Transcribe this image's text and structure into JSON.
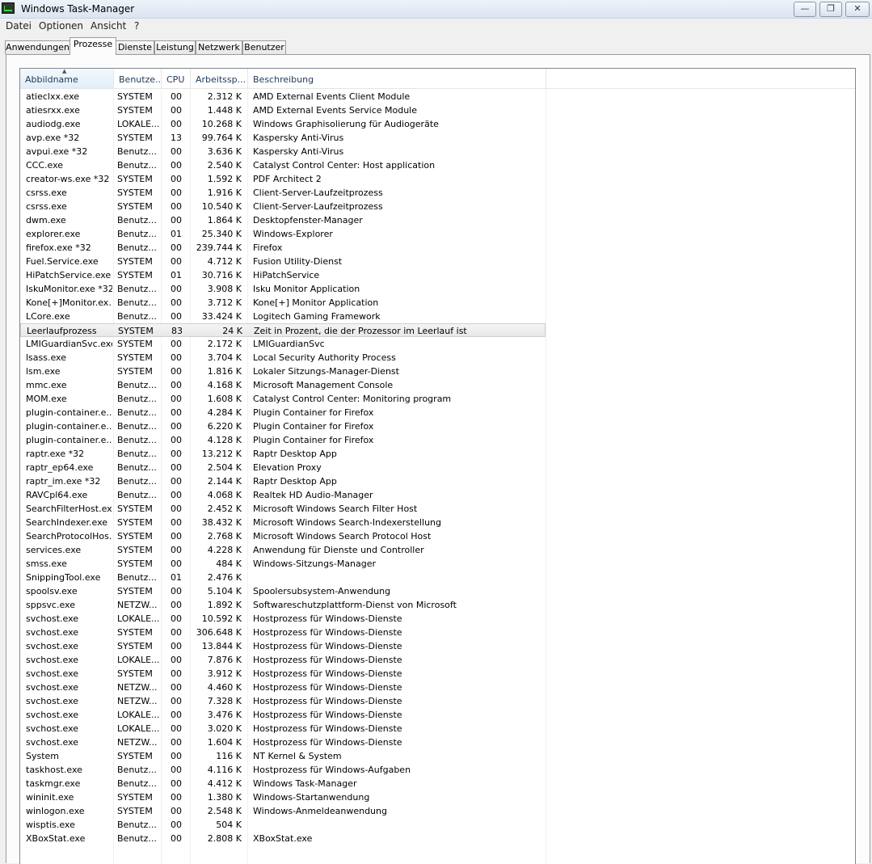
{
  "window": {
    "title": "Windows Task-Manager",
    "minimize_symbol": "—",
    "maximize_symbol": "❐",
    "close_symbol": "✕"
  },
  "menu": {
    "items": [
      "Datei",
      "Optionen",
      "Ansicht",
      "?"
    ]
  },
  "tabs": [
    {
      "label": "Anwendungen"
    },
    {
      "label": "Prozesse",
      "active": true
    },
    {
      "label": "Dienste"
    },
    {
      "label": "Leistung"
    },
    {
      "label": "Netzwerk"
    },
    {
      "label": "Benutzer"
    }
  ],
  "columns": {
    "name": "Abbildname",
    "user": "Benutze...",
    "cpu": "CPU",
    "mem": "Arbeitssp...",
    "desc": "Beschreibung"
  },
  "processes": [
    {
      "name": "atieclxx.exe",
      "user": "SYSTEM",
      "cpu": "00",
      "mem": "2.312 K",
      "desc": "AMD External Events Client Module"
    },
    {
      "name": "atiesrxx.exe",
      "user": "SYSTEM",
      "cpu": "00",
      "mem": "1.448 K",
      "desc": "AMD External Events Service Module"
    },
    {
      "name": "audiodg.exe",
      "user": "LOKALE...",
      "cpu": "00",
      "mem": "10.268 K",
      "desc": "Windows Graphisolierung für Audiogeräte"
    },
    {
      "name": "avp.exe *32",
      "user": "SYSTEM",
      "cpu": "13",
      "mem": "99.764 K",
      "desc": "Kaspersky Anti-Virus"
    },
    {
      "name": "avpui.exe *32",
      "user": "Benutz...",
      "cpu": "00",
      "mem": "3.636 K",
      "desc": "Kaspersky Anti-Virus"
    },
    {
      "name": "CCC.exe",
      "user": "Benutz...",
      "cpu": "00",
      "mem": "2.540 K",
      "desc": "Catalyst Control Center: Host application"
    },
    {
      "name": "creator-ws.exe *32",
      "user": "SYSTEM",
      "cpu": "00",
      "mem": "1.592 K",
      "desc": "PDF Architect 2"
    },
    {
      "name": "csrss.exe",
      "user": "SYSTEM",
      "cpu": "00",
      "mem": "1.916 K",
      "desc": "Client-Server-Laufzeitprozess"
    },
    {
      "name": "csrss.exe",
      "user": "SYSTEM",
      "cpu": "00",
      "mem": "10.540 K",
      "desc": "Client-Server-Laufzeitprozess"
    },
    {
      "name": "dwm.exe",
      "user": "Benutz...",
      "cpu": "00",
      "mem": "1.864 K",
      "desc": "Desktopfenster-Manager"
    },
    {
      "name": "explorer.exe",
      "user": "Benutz...",
      "cpu": "01",
      "mem": "25.340 K",
      "desc": "Windows-Explorer"
    },
    {
      "name": "firefox.exe *32",
      "user": "Benutz...",
      "cpu": "00",
      "mem": "239.744 K",
      "desc": "Firefox"
    },
    {
      "name": "Fuel.Service.exe",
      "user": "SYSTEM",
      "cpu": "00",
      "mem": "4.712 K",
      "desc": "Fusion Utility-Dienst"
    },
    {
      "name": "HiPatchService.exe",
      "user": "SYSTEM",
      "cpu": "01",
      "mem": "30.716 K",
      "desc": "HiPatchService"
    },
    {
      "name": "IskuMonitor.exe *32",
      "user": "Benutz...",
      "cpu": "00",
      "mem": "3.908 K",
      "desc": "Isku Monitor Application"
    },
    {
      "name": "Kone[+]Monitor.ex...",
      "user": "Benutz...",
      "cpu": "00",
      "mem": "3.712 K",
      "desc": "Kone[+] Monitor Application"
    },
    {
      "name": "LCore.exe",
      "user": "Benutz...",
      "cpu": "00",
      "mem": "33.424 K",
      "desc": "Logitech Gaming Framework"
    },
    {
      "name": "Leerlaufprozess",
      "user": "SYSTEM",
      "cpu": "83",
      "mem": "24 K",
      "desc": "Zeit in Prozent, die der Prozessor im Leerlauf ist",
      "selected": true
    },
    {
      "name": "LMIGuardianSvc.exe",
      "user": "SYSTEM",
      "cpu": "00",
      "mem": "2.172 K",
      "desc": "LMIGuardianSvc"
    },
    {
      "name": "lsass.exe",
      "user": "SYSTEM",
      "cpu": "00",
      "mem": "3.704 K",
      "desc": "Local Security Authority Process"
    },
    {
      "name": "lsm.exe",
      "user": "SYSTEM",
      "cpu": "00",
      "mem": "1.816 K",
      "desc": "Lokaler Sitzungs-Manager-Dienst"
    },
    {
      "name": "mmc.exe",
      "user": "Benutz...",
      "cpu": "00",
      "mem": "4.168 K",
      "desc": "Microsoft Management Console"
    },
    {
      "name": "MOM.exe",
      "user": "Benutz...",
      "cpu": "00",
      "mem": "1.608 K",
      "desc": "Catalyst Control Center: Monitoring program"
    },
    {
      "name": "plugin-container.e...",
      "user": "Benutz...",
      "cpu": "00",
      "mem": "4.284 K",
      "desc": "Plugin Container for Firefox"
    },
    {
      "name": "plugin-container.e...",
      "user": "Benutz...",
      "cpu": "00",
      "mem": "6.220 K",
      "desc": "Plugin Container for Firefox"
    },
    {
      "name": "plugin-container.e...",
      "user": "Benutz...",
      "cpu": "00",
      "mem": "4.128 K",
      "desc": "Plugin Container for Firefox"
    },
    {
      "name": "raptr.exe *32",
      "user": "Benutz...",
      "cpu": "00",
      "mem": "13.212 K",
      "desc": "Raptr Desktop App"
    },
    {
      "name": "raptr_ep64.exe",
      "user": "Benutz...",
      "cpu": "00",
      "mem": "2.504 K",
      "desc": "Elevation Proxy"
    },
    {
      "name": "raptr_im.exe *32",
      "user": "Benutz...",
      "cpu": "00",
      "mem": "2.144 K",
      "desc": "Raptr Desktop App"
    },
    {
      "name": "RAVCpl64.exe",
      "user": "Benutz...",
      "cpu": "00",
      "mem": "4.068 K",
      "desc": "Realtek HD Audio-Manager"
    },
    {
      "name": "SearchFilterHost.exe",
      "user": "SYSTEM",
      "cpu": "00",
      "mem": "2.452 K",
      "desc": "Microsoft Windows Search Filter Host"
    },
    {
      "name": "SearchIndexer.exe",
      "user": "SYSTEM",
      "cpu": "00",
      "mem": "38.432 K",
      "desc": "Microsoft Windows Search-Indexerstellung"
    },
    {
      "name": "SearchProtocolHos...",
      "user": "SYSTEM",
      "cpu": "00",
      "mem": "2.768 K",
      "desc": "Microsoft Windows Search Protocol Host"
    },
    {
      "name": "services.exe",
      "user": "SYSTEM",
      "cpu": "00",
      "mem": "4.228 K",
      "desc": "Anwendung für Dienste und Controller"
    },
    {
      "name": "smss.exe",
      "user": "SYSTEM",
      "cpu": "00",
      "mem": "484 K",
      "desc": "Windows-Sitzungs-Manager"
    },
    {
      "name": "SnippingTool.exe",
      "user": "Benutz...",
      "cpu": "01",
      "mem": "2.476 K",
      "desc": ""
    },
    {
      "name": "spoolsv.exe",
      "user": "SYSTEM",
      "cpu": "00",
      "mem": "5.104 K",
      "desc": "Spoolersubsystem-Anwendung"
    },
    {
      "name": "sppsvc.exe",
      "user": "NETZW...",
      "cpu": "00",
      "mem": "1.892 K",
      "desc": "Softwareschutzplattform-Dienst von Microsoft"
    },
    {
      "name": "svchost.exe",
      "user": "LOKALE...",
      "cpu": "00",
      "mem": "10.592 K",
      "desc": "Hostprozess für Windows-Dienste"
    },
    {
      "name": "svchost.exe",
      "user": "SYSTEM",
      "cpu": "00",
      "mem": "306.648 K",
      "desc": "Hostprozess für Windows-Dienste"
    },
    {
      "name": "svchost.exe",
      "user": "SYSTEM",
      "cpu": "00",
      "mem": "13.844 K",
      "desc": "Hostprozess für Windows-Dienste"
    },
    {
      "name": "svchost.exe",
      "user": "LOKALE...",
      "cpu": "00",
      "mem": "7.876 K",
      "desc": "Hostprozess für Windows-Dienste"
    },
    {
      "name": "svchost.exe",
      "user": "SYSTEM",
      "cpu": "00",
      "mem": "3.912 K",
      "desc": "Hostprozess für Windows-Dienste"
    },
    {
      "name": "svchost.exe",
      "user": "NETZW...",
      "cpu": "00",
      "mem": "4.460 K",
      "desc": "Hostprozess für Windows-Dienste"
    },
    {
      "name": "svchost.exe",
      "user": "NETZW...",
      "cpu": "00",
      "mem": "7.328 K",
      "desc": "Hostprozess für Windows-Dienste"
    },
    {
      "name": "svchost.exe",
      "user": "LOKALE...",
      "cpu": "00",
      "mem": "3.476 K",
      "desc": "Hostprozess für Windows-Dienste"
    },
    {
      "name": "svchost.exe",
      "user": "LOKALE...",
      "cpu": "00",
      "mem": "3.020 K",
      "desc": "Hostprozess für Windows-Dienste"
    },
    {
      "name": "svchost.exe",
      "user": "NETZW...",
      "cpu": "00",
      "mem": "1.604 K",
      "desc": "Hostprozess für Windows-Dienste"
    },
    {
      "name": "System",
      "user": "SYSTEM",
      "cpu": "00",
      "mem": "116 K",
      "desc": "NT Kernel & System"
    },
    {
      "name": "taskhost.exe",
      "user": "Benutz...",
      "cpu": "00",
      "mem": "4.116 K",
      "desc": "Hostprozess für Windows-Aufgaben"
    },
    {
      "name": "taskmgr.exe",
      "user": "Benutz...",
      "cpu": "00",
      "mem": "4.412 K",
      "desc": "Windows Task-Manager"
    },
    {
      "name": "wininit.exe",
      "user": "SYSTEM",
      "cpu": "00",
      "mem": "1.380 K",
      "desc": "Windows-Startanwendung"
    },
    {
      "name": "winlogon.exe",
      "user": "SYSTEM",
      "cpu": "00",
      "mem": "2.548 K",
      "desc": "Windows-Anmeldeanwendung"
    },
    {
      "name": "wisptis.exe",
      "user": "Benutz...",
      "cpu": "00",
      "mem": "504 K",
      "desc": ""
    },
    {
      "name": "XBoxStat.exe",
      "user": "Benutz...",
      "cpu": "00",
      "mem": "2.808 K",
      "desc": "XBoxStat.exe"
    }
  ]
}
